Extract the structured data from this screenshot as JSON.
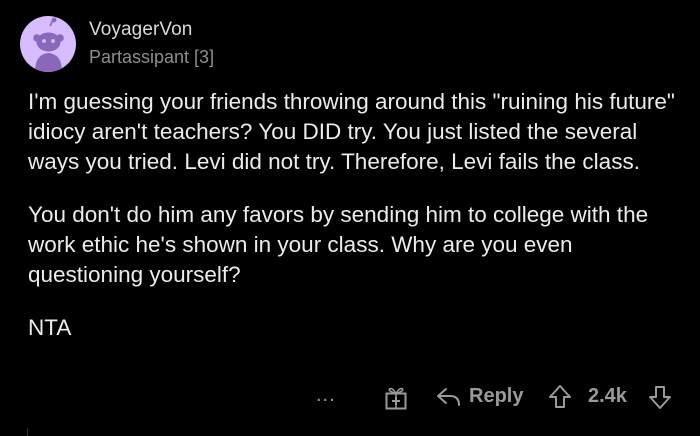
{
  "comment": {
    "username": "VoyagerVon",
    "flair": "Partassipant [3]",
    "paragraphs": [
      "I'm guessing your friends throwing around this \"ruining his future\" idiocy aren't teachers? You DID try. You just listed the several ways you tried. Levi did not try. Therefore, Levi fails the class.",
      "You don't do him any favors by sending him to college with the work ethic he's shown in your class. Why are you even questioning yourself?",
      "NTA"
    ]
  },
  "actions": {
    "more_label": "...",
    "reply_label": "Reply",
    "score": "2.4k"
  },
  "icons": {
    "avatar": "snoo-avatar-icon",
    "award": "award-gift-icon",
    "reply": "reply-arrow-icon",
    "upvote": "upvote-arrow-icon",
    "downvote": "downvote-arrow-icon"
  },
  "colors": {
    "background": "#000000",
    "avatar_bg": "#d7bdfe",
    "text": "#ececec",
    "muted": "#9a9a9a"
  }
}
